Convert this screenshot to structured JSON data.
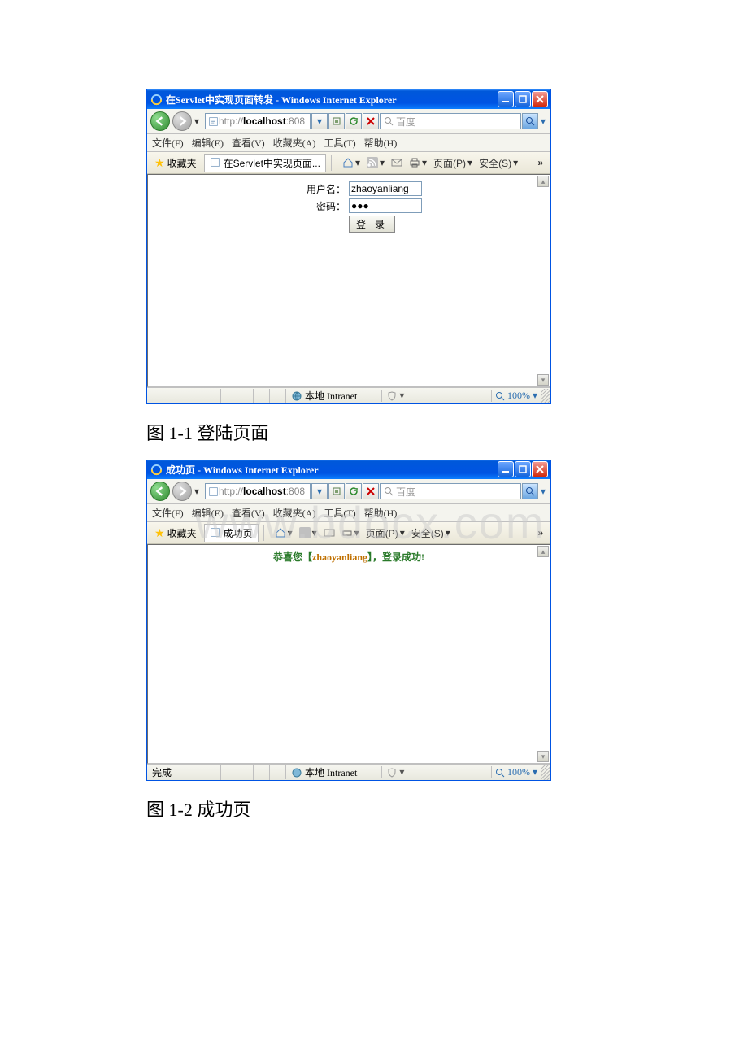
{
  "watermark": "www.bdocx.com",
  "captions": {
    "fig1": "图 1-1    登陆页面",
    "fig2": "图 1-2 成功页"
  },
  "menubar": {
    "file": "文件(F)",
    "edit": "编辑(E)",
    "view": "查看(V)",
    "fav": "收藏夹(A)",
    "tools": "工具(T)",
    "help": "帮助(H)"
  },
  "favs_label": "收藏夹",
  "cmdbar": {
    "page": "页面(P)",
    "safety": "安全(S)",
    "expand": "»"
  },
  "common": {
    "search_placeholder": "百度",
    "zone": "本地 Intranet",
    "zoom": "100%",
    "url_prefix": "http://",
    "url_host": "localhost",
    "url_port": ":808"
  },
  "win1": {
    "title": "在Servlet中实现页面转发 - Windows Internet Explorer",
    "tab": "在Servlet中实现页面...",
    "form": {
      "user_label": "用户名：",
      "user_value": "zhaoyanliang",
      "pass_label": "密码：",
      "pass_value": "●●●",
      "login": "登 录"
    },
    "status_left": ""
  },
  "win2": {
    "title": "成功页 - Windows Internet Explorer",
    "tab": "成功页",
    "success_pre": "恭喜您【",
    "success_user": "zhaoyanliang",
    "success_post": "】，登录成功!",
    "status_left": "完成"
  }
}
